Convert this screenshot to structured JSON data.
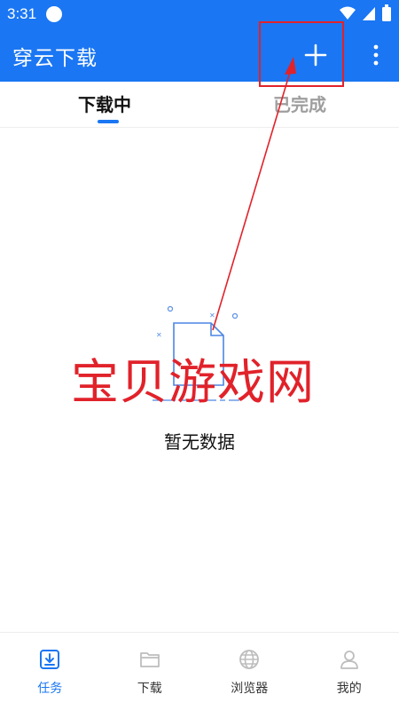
{
  "status_bar": {
    "time": "3:31"
  },
  "app_bar": {
    "title": "穿云下载"
  },
  "tabs": [
    {
      "label": "下载中"
    },
    {
      "label": "已完成"
    }
  ],
  "empty_state": {
    "message": "暂无数据"
  },
  "watermark": {
    "text": "宝贝游戏网"
  },
  "bottom_nav": [
    {
      "label": "任务",
      "icon": "download-task-icon"
    },
    {
      "label": "下载",
      "icon": "folder-icon"
    },
    {
      "label": "浏览器",
      "icon": "globe-icon"
    },
    {
      "label": "我的",
      "icon": "user-icon"
    }
  ],
  "colors": {
    "primary": "#1a76f3",
    "annotation": "#e1222a"
  }
}
